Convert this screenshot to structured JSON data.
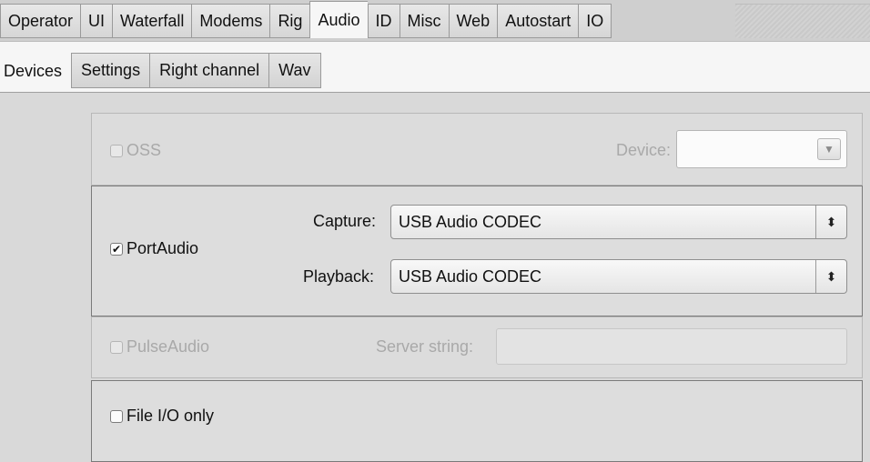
{
  "top_tabs": [
    "Operator",
    "UI",
    "Waterfall",
    "Modems",
    "Rig",
    "Audio",
    "ID",
    "Misc",
    "Web",
    "Autostart",
    "IO"
  ],
  "top_tabs_active": "Audio",
  "sub_tabs": [
    "Devices",
    "Settings",
    "Right channel",
    "Wav"
  ],
  "sub_tabs_active": "Devices",
  "oss": {
    "label": "OSS",
    "checked": false,
    "enabled": false,
    "device_label": "Device:",
    "device_value": ""
  },
  "portaudio": {
    "label": "PortAudio",
    "checked": true,
    "capture_label": "Capture:",
    "capture_value": "USB Audio CODEC",
    "playback_label": "Playback:",
    "playback_value": "USB Audio CODEC"
  },
  "pulseaudio": {
    "label": "PulseAudio",
    "checked": false,
    "enabled": false,
    "server_label": "Server string:",
    "server_value": ""
  },
  "fileio": {
    "label": "File I/O only",
    "checked": false
  },
  "icons": {
    "check": "check-icon",
    "dropdown": "triangle-down-icon",
    "stepper": "up-down-arrows-icon"
  }
}
